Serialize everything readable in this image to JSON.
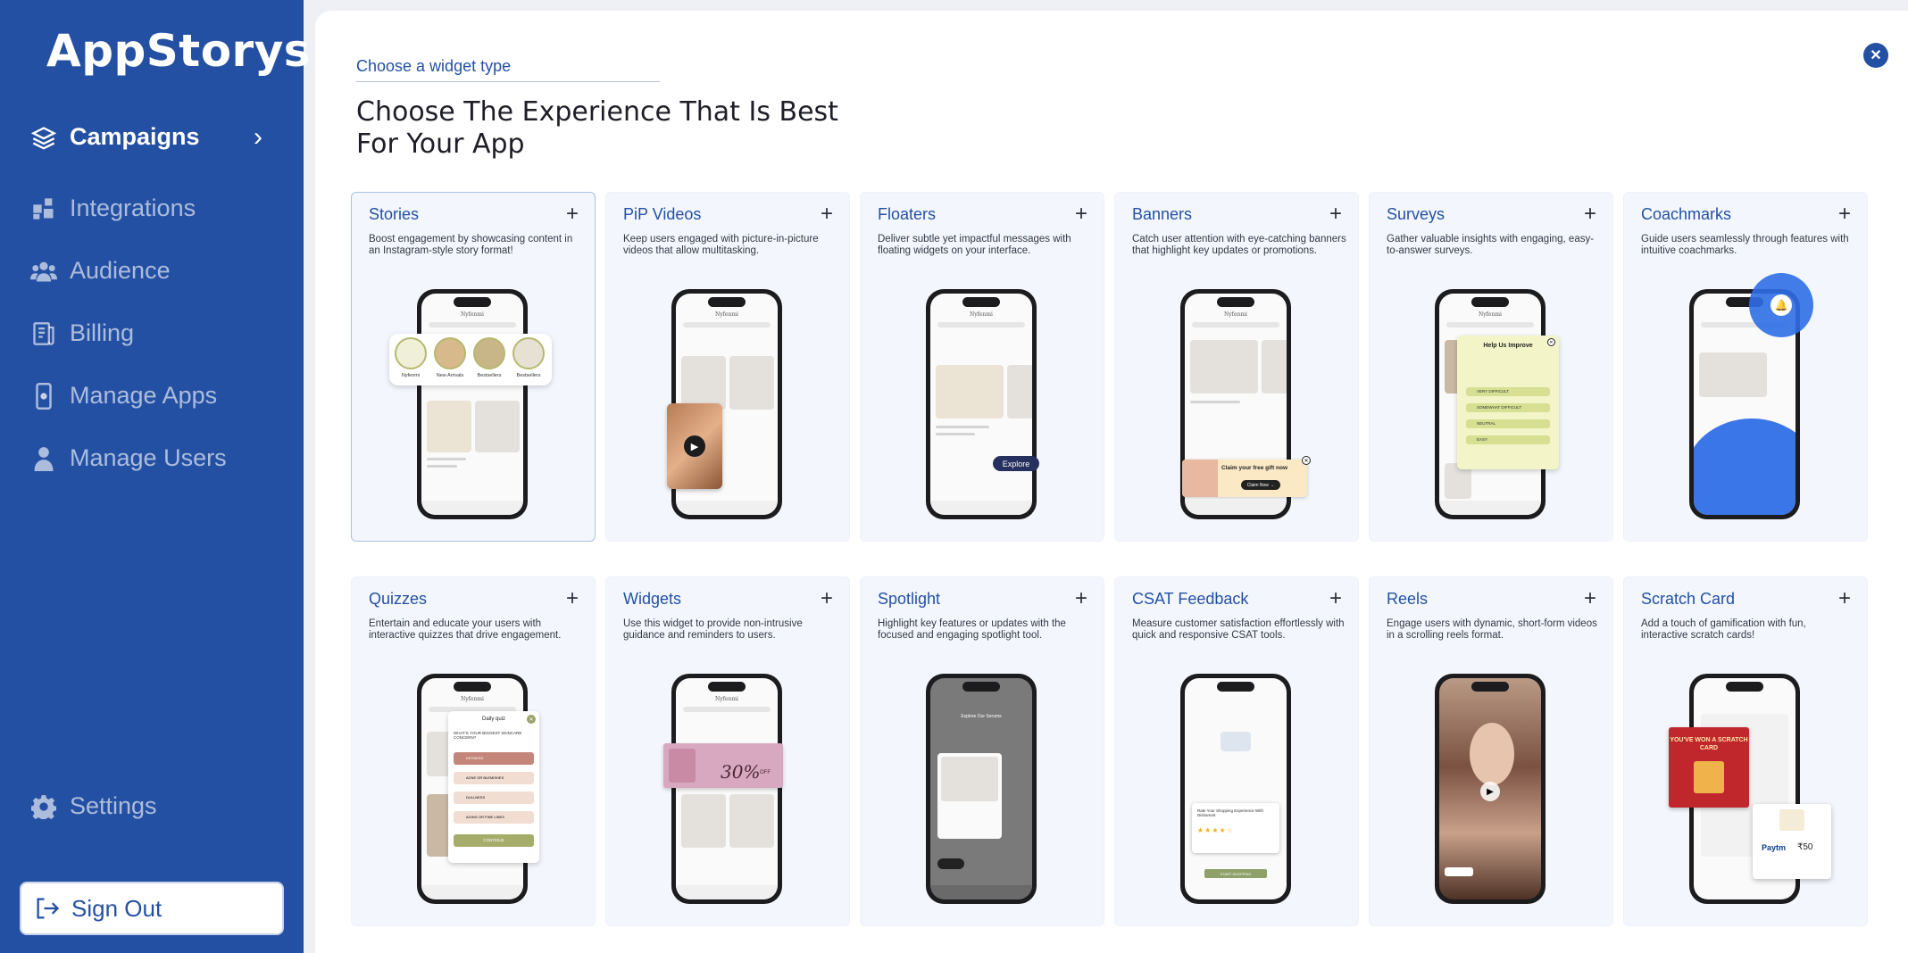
{
  "sidebar": {
    "logo": "AppStorys",
    "items": [
      {
        "label": "Campaigns",
        "icon": "layers-icon"
      },
      {
        "label": "Integrations",
        "icon": "puzzle-icon"
      },
      {
        "label": "Audience",
        "icon": "users-icon"
      },
      {
        "label": "Billing",
        "icon": "receipt-icon"
      },
      {
        "label": "Manage Apps",
        "icon": "phone-icon"
      },
      {
        "label": "Manage Users",
        "icon": "user-icon"
      }
    ],
    "settings": "Settings",
    "signout": "Sign Out"
  },
  "main": {
    "breadcrumb": "Choose a widget type",
    "heading": "Choose The Experience That Is Best For Your App"
  },
  "cards": [
    {
      "title": "Stories",
      "desc": "Boost engagement by showcasing content in an Instagram-style story format!"
    },
    {
      "title": "PiP Videos",
      "desc": "Keep users engaged with picture-in-picture videos that allow multitasking."
    },
    {
      "title": "Floaters",
      "desc": "Deliver subtle yet impactful messages with floating widgets on your interface."
    },
    {
      "title": "Banners",
      "desc": "Catch user attention with eye-catching banners that highlight key updates or promotions."
    },
    {
      "title": "Surveys",
      "desc": "Gather valuable insights with engaging, easy-to-answer surveys."
    },
    {
      "title": "Coachmarks",
      "desc": "Guide users seamlessly through features with intuitive coachmarks."
    },
    {
      "title": "Quizzes",
      "desc": "Entertain and educate your users with interactive quizzes that drive engagement."
    },
    {
      "title": "Widgets",
      "desc": "Use this widget to provide non-intrusive guidance and reminders to users."
    },
    {
      "title": "Spotlight",
      "desc": "Highlight key features or updates with the focused and engaging spotlight tool."
    },
    {
      "title": "CSAT Feedback",
      "desc": "Measure customer satisfaction effortlessly with quick and responsive CSAT tools."
    },
    {
      "title": "Reels",
      "desc": "Engage users with dynamic, short-form videos in a scrolling reels format."
    },
    {
      "title": "Scratch Card",
      "desc": "Add a touch of gamification with fun, interactive scratch cards!"
    }
  ],
  "mock": {
    "brand": "Nyfenmi",
    "story_labels": [
      "Nyfenmi",
      "New Arrivals",
      "Bestsellers",
      "Bestsellers"
    ],
    "floater_button": "Explore",
    "banner_text": "Claim your free gift now",
    "banner_cta": "Claim Now →",
    "survey_title": "Help Us Improve",
    "survey_options": [
      "VERY DIFFICULT",
      "SOMEWHAT DIFFICULT",
      "NEUTRAL",
      "EASY"
    ],
    "quiz_title": "Daily quiz",
    "quiz_question": "WHAT'S YOUR BIGGEST SKINCARE CONCERN?",
    "quiz_options": [
      "DRYNESS",
      "ACNE OR BLEMISHES",
      "DULLNESS",
      "AGING OR FINE LINES"
    ],
    "quiz_cta": "CONTINUE",
    "widget_offer": "30%",
    "widget_off": "OFF",
    "spotlight_text": "Explore Our Serums",
    "csat_title": "Rate Your Shopping Experience With Dishamart",
    "csat_cta": "START SHOPPING",
    "scratch_banner": "YOU'VE WON A SCRATCH CARD",
    "scratch_brand": "Paytm",
    "scratch_amount": "₹50"
  },
  "colors": {
    "sidebar": "#2450a3",
    "accent": "#2450a3",
    "card_bg": "#f3f7fd",
    "survey_bg": "#f3f5c8",
    "quiz_accent": "#c4867a",
    "coach_blue": "#2f6fe6"
  }
}
